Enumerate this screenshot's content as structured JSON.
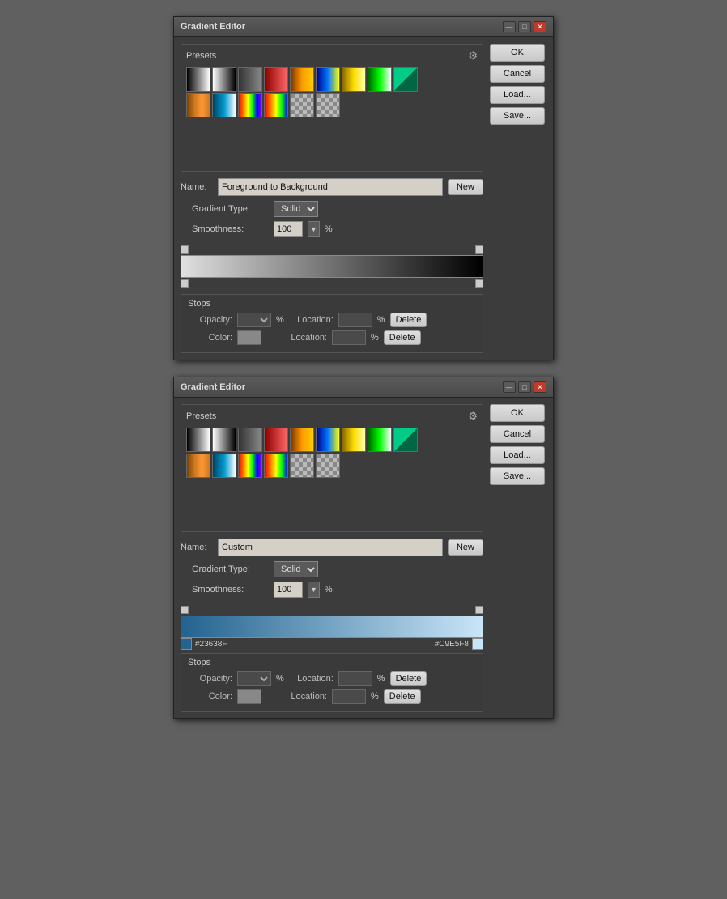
{
  "dialog1": {
    "title": "Gradient Editor",
    "presets": {
      "label": "Presets",
      "gear": "⚙",
      "rows": [
        [
          "g-black-white",
          "g-white-black",
          "g-black-trans",
          "g-red-grad",
          "g-orange-grad",
          "g-blue-yellow",
          "g-yellow-grad",
          "g-green-white",
          "g-checker"
        ],
        [
          "g-copper",
          "g-cyan-grad",
          "g-rainbow2",
          "g-green-rainbow",
          "g-checker3",
          "g-checker4"
        ]
      ]
    },
    "name_label": "Name:",
    "name_value": "Foreground to Background",
    "new_label": "New",
    "gradient_type_label": "Gradient Type:",
    "gradient_type_value": "Solid",
    "smoothness_label": "Smoothness:",
    "smoothness_value": "100",
    "percent": "%",
    "stops": {
      "label": "Stops",
      "opacity_label": "Opacity:",
      "location_label": "Location:",
      "delete_label": "Delete",
      "color_label": "Color:",
      "percent": "%"
    },
    "buttons": {
      "ok": "OK",
      "cancel": "Cancel",
      "load": "Load...",
      "save": "Save..."
    },
    "winbtns": [
      "—",
      "□",
      "✕"
    ]
  },
  "dialog2": {
    "title": "Gradient Editor",
    "presets": {
      "label": "Presets",
      "gear": "⚙"
    },
    "name_label": "Name:",
    "name_value": "Custom",
    "new_label": "New",
    "gradient_type_label": "Gradient Type:",
    "gradient_type_value": "Solid",
    "smoothness_label": "Smoothness:",
    "smoothness_value": "100",
    "percent": "%",
    "color_left_hex": "#23638F",
    "color_right_hex": "#C9E5F8",
    "stops": {
      "label": "Stops",
      "opacity_label": "Opacity:",
      "location_label": "Location:",
      "delete_label": "Delete",
      "color_label": "Color:",
      "percent": "%"
    },
    "buttons": {
      "ok": "OK",
      "cancel": "Cancel",
      "load": "Load...",
      "save": "Save..."
    },
    "winbtns": [
      "—",
      "□",
      "✕"
    ]
  }
}
